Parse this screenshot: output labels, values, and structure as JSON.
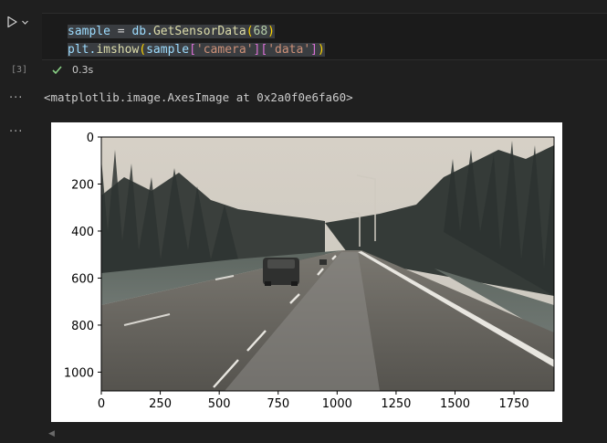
{
  "cell": {
    "execution_count": "[3]",
    "code": {
      "line1": {
        "var": "sample",
        "op": " = ",
        "obj": "db.",
        "fn": "GetSensorData",
        "open": "(",
        "num": "68",
        "close": ")"
      },
      "line2": {
        "obj": "plt.",
        "fn": "imshow",
        "open": "(",
        "arg": "sample",
        "b1o": "[",
        "s1": "'camera'",
        "b1c": "]",
        "b2o": "[",
        "s2": "'data'",
        "b2c": "]",
        "close": ")"
      }
    },
    "status": {
      "duration": "0.3s"
    }
  },
  "output": {
    "text": "<matplotlib.image.AxesImage at 0x2a0f0e6fa60>",
    "more_glyph": "···"
  },
  "chart_data": {
    "type": "image",
    "x_ticks": [
      "0",
      "250",
      "500",
      "750",
      "1000",
      "1250",
      "1500",
      "1750"
    ],
    "y_ticks": [
      "0",
      "200",
      "400",
      "600",
      "800",
      "1000"
    ],
    "xlim": [
      0,
      1920
    ],
    "ylim": [
      1080,
      0
    ],
    "image_description": "Dashcam road scene: divided highway, car ahead, bare trees, overcast sky"
  },
  "colors": {
    "success": "#89d185",
    "background": "#1f1f1f"
  },
  "icons": {
    "run": "play-icon",
    "menu": "chevron-down-icon",
    "check": "check-icon",
    "scroll_left": "caret-left-icon"
  }
}
